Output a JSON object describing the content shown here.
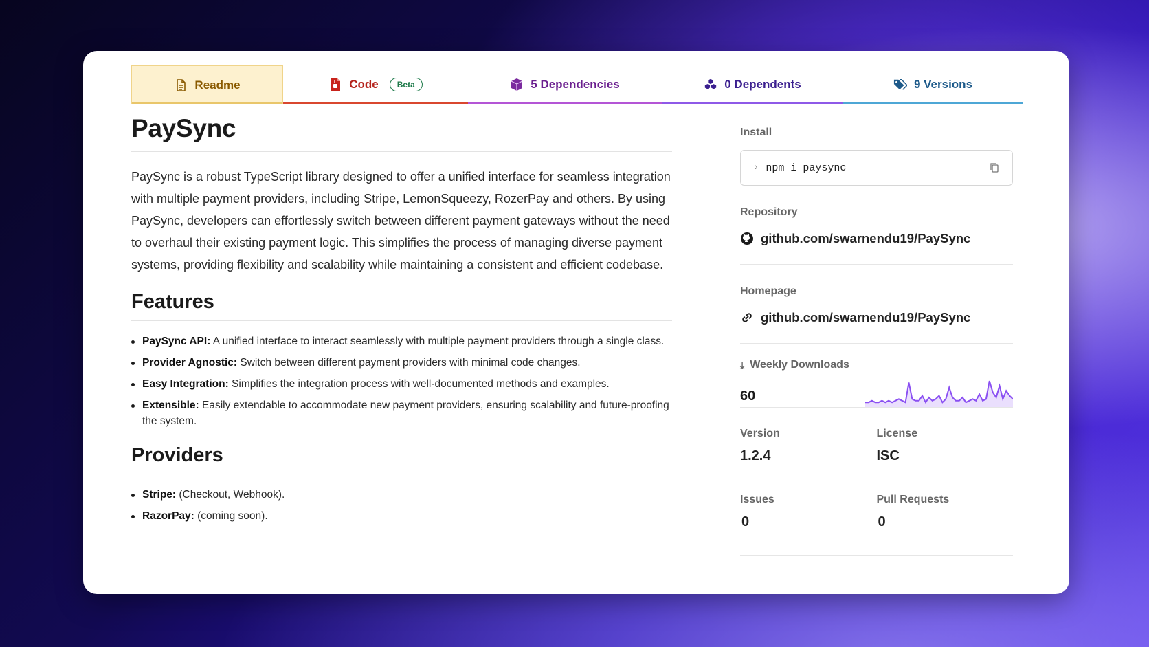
{
  "tabs": [
    {
      "label": "Readme",
      "color": "#8a5a00",
      "line": "#e9c66a"
    },
    {
      "label": "Code",
      "badge": "Beta",
      "color": "#b4231c",
      "line": "#d9472f"
    },
    {
      "label": "5 Dependencies",
      "color": "#6b1f8f",
      "line": "#b455d6"
    },
    {
      "label": "0 Dependents",
      "color": "#3b1f8f",
      "line": "#8e59e8"
    },
    {
      "label": "9 Versions",
      "color": "#1d5a8a",
      "line": "#4ea7d6"
    }
  ],
  "readme": {
    "title": "PaySync",
    "description": "PaySync is a robust TypeScript library designed to offer a unified interface for seamless integration with multiple payment providers, including Stripe, LemonSqueezy, RozerPay and others. By using PaySync, developers can effortlessly switch between different payment gateways without the need to overhaul their existing payment logic. This simplifies the process of managing diverse payment systems, providing flexibility and scalability while maintaining a consistent and efficient codebase.",
    "features_heading": "Features",
    "features": [
      {
        "term": "PaySync API:",
        "text": " A unified interface to interact seamlessly with multiple payment providers through a single class."
      },
      {
        "term": "Provider Agnostic:",
        "text": " Switch between different payment providers with minimal code changes."
      },
      {
        "term": "Easy Integration:",
        "text": " Simplifies the integration process with well-documented methods and examples."
      },
      {
        "term": "Extensible:",
        "text": " Easily extendable to accommodate new payment providers, ensuring scalability and future-proofing the system."
      }
    ],
    "providers_heading": "Providers",
    "providers": [
      {
        "term": "Stripe:",
        "text": " (Checkout, Webhook)."
      },
      {
        "term": "RazorPay:",
        "text": " (coming soon)."
      }
    ]
  },
  "sidebar": {
    "install_label": "Install",
    "install_cmd": "npm i paysync",
    "repository_label": "Repository",
    "repository": "github.com/swarnendu19/PaySync",
    "homepage_label": "Homepage",
    "homepage": "github.com/swarnendu19/PaySync",
    "downloads_label": "Weekly Downloads",
    "downloads": "60",
    "downloads_series": [
      2,
      2,
      3,
      2,
      2,
      3,
      2,
      3,
      2,
      3,
      4,
      3,
      2,
      14,
      4,
      3,
      3,
      6,
      2,
      5,
      3,
      4,
      6,
      2,
      4,
      11,
      5,
      3,
      3,
      5,
      2,
      3,
      4,
      3,
      7,
      3,
      4,
      15,
      8,
      5,
      12,
      4,
      9,
      6,
      4
    ],
    "version_label": "Version",
    "version": "1.2.4",
    "license_label": "License",
    "license": "ISC",
    "issues_label": "Issues",
    "issues": "0",
    "pulls_label": "Pull Requests",
    "pulls": "0",
    "sparkline_color": "#8a4ff2"
  }
}
